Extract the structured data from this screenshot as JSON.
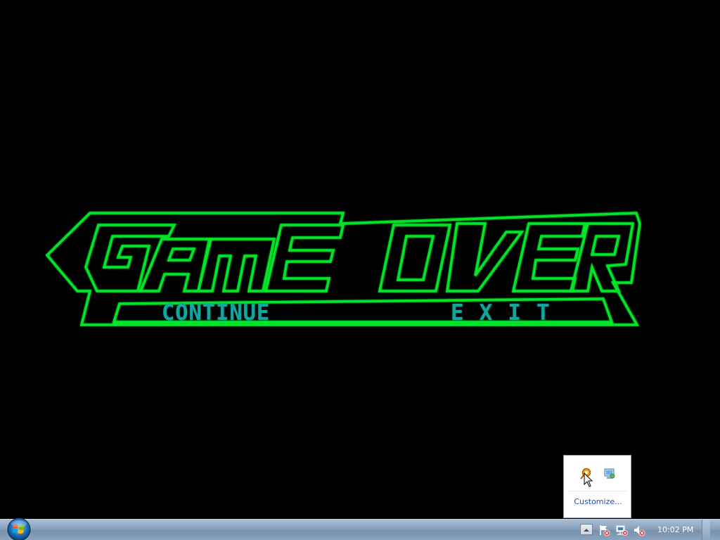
{
  "game": {
    "title_text": "GAME OVER",
    "menu": {
      "continue_label": "CONTINUE",
      "exit_label": "EXIT"
    },
    "colors": {
      "outline": "#00e52a",
      "menu_text": "#0fa89f",
      "background": "#000000"
    }
  },
  "tray_popup": {
    "icons": [
      "orange-ring-app-icon",
      "desktop-app-icon"
    ],
    "customize_label": "Customize..."
  },
  "taskbar": {
    "start_icon": "windows-orb-icon",
    "tray_icons": [
      "show-hidden-icons-icon",
      "action-center-icon",
      "network-icon",
      "volume-muted-icon"
    ],
    "clock": "10:02 PM"
  }
}
